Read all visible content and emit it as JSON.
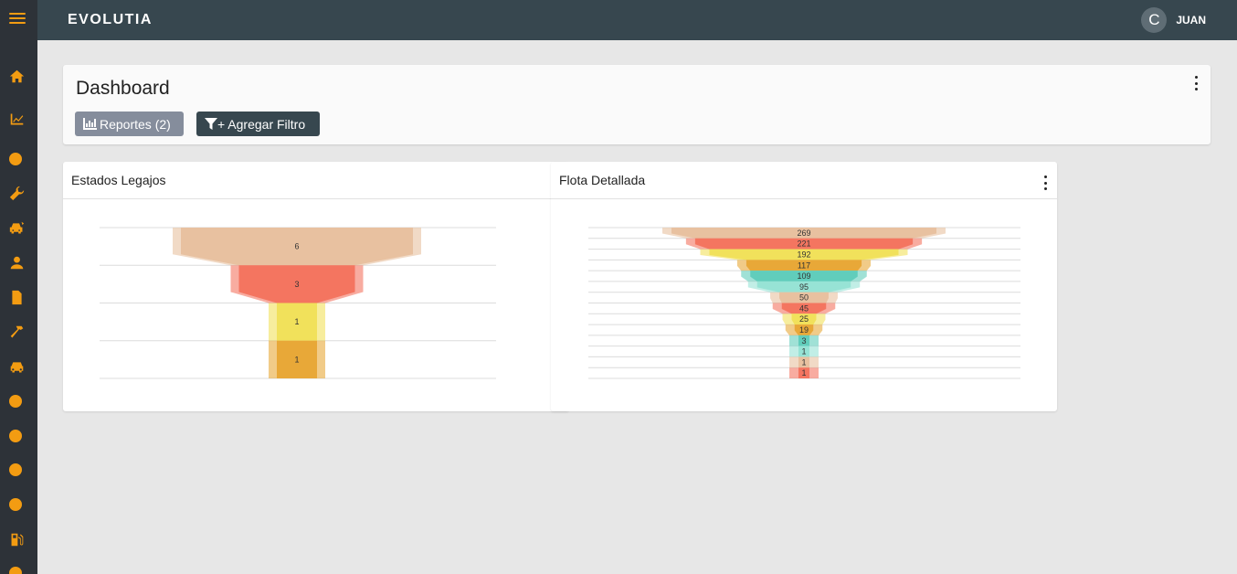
{
  "app": {
    "brand": "EVOLUTIA"
  },
  "user": {
    "initial": "C",
    "name": "JUAN"
  },
  "sidebar": {
    "icons": [
      "menu-icon",
      "home-icon",
      "line-chart-icon",
      "dot-icon",
      "wrench-icon",
      "car-crash-icon",
      "user-icon",
      "document-icon",
      "hammer-icon",
      "car-icon",
      "dot-icon",
      "dot-icon",
      "dot-icon",
      "dot-icon",
      "gas-pump-icon",
      "dot-icon"
    ]
  },
  "dashboard": {
    "title": "Dashboard",
    "reports_button": "Reportes (2)",
    "filter_button": "+ Agregar Filtro"
  },
  "panels": [
    {
      "title": "Estados Legajos"
    },
    {
      "title": "Flota Detallada"
    }
  ],
  "colors": {
    "sidebar_bg": "#2d3238",
    "topbar_bg": "#37474f",
    "accent": "#f39c12",
    "funnel_peach": "#e8c1a0",
    "funnel_red": "#f47560",
    "funnel_yellow": "#f1e15b",
    "funnel_orange": "#e8a838",
    "funnel_teal": "#61cdbb",
    "funnel_teal_light": "#97e3d5"
  },
  "chart_data": [
    {
      "type": "funnel",
      "title": "Estados Legajos",
      "values": [
        6,
        3,
        1,
        1
      ],
      "colors": [
        "#e8c1a0",
        "#f47560",
        "#f1e15b",
        "#e8a838"
      ]
    },
    {
      "type": "funnel",
      "title": "Flota Detallada",
      "values": [
        269,
        221,
        192,
        117,
        109,
        95,
        50,
        45,
        25,
        19,
        3,
        1,
        1,
        1
      ],
      "colors": [
        "#e8c1a0",
        "#f47560",
        "#f1e15b",
        "#e8a838",
        "#61cdbb",
        "#97e3d5",
        "#e8c1a0",
        "#f47560",
        "#f1e15b",
        "#e8a838",
        "#61cdbb",
        "#97e3d5",
        "#e8c1a0",
        "#f47560"
      ]
    }
  ]
}
